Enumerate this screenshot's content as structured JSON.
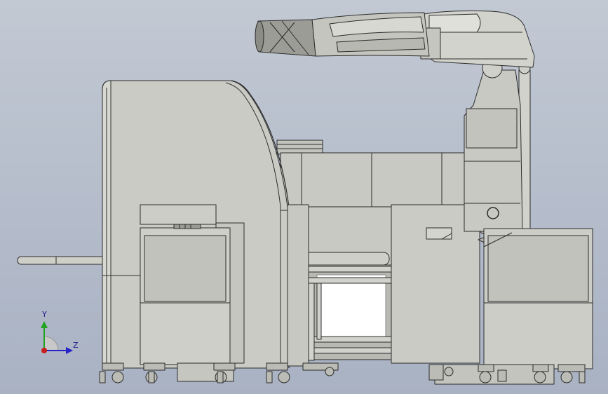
{
  "model": {
    "colors": {
      "body": "#c8c8c2",
      "body_light": "#d6d6d0",
      "body_dark": "#a8a8a2",
      "edge": "#2c2c2c",
      "background_top": "#c2c9d3",
      "background_bottom": "#a9b2c3"
    }
  },
  "triad": {
    "y_label": "Y",
    "z_label": "Z",
    "y_color": "#21a321",
    "z_color": "#2424c8",
    "origin_color": "#c81e1e"
  }
}
